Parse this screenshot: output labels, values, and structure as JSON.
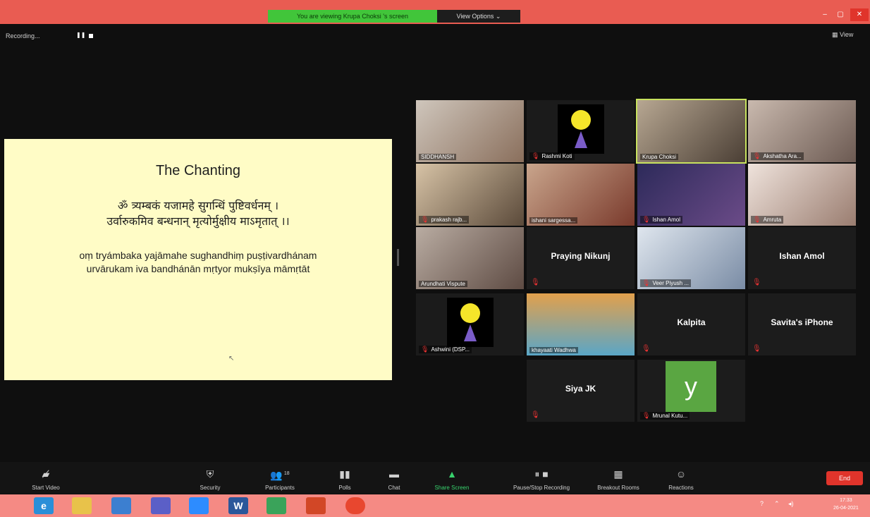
{
  "window": {
    "viewing_banner": "You are viewing Krupa Choksi 's screen",
    "view_options": "View Options ⌄",
    "min": "–",
    "max": "▢",
    "close": "✕"
  },
  "recording": {
    "label": "Recording...",
    "pause": "❚❚"
  },
  "view_button": "▦ View",
  "slide": {
    "title": "The Chanting",
    "sanskrit_line1": "ॐ त्र्यम्बकं यजामहे सुगन्धिं पुष्टिवर्धनम् ।",
    "sanskrit_line2": "उर्वारुकमिव बन्धनान् मृत्योर्मुक्षीय माऽमृतात् ।।",
    "trans_line1": "oṃ tryámbaka yajāmahe sughandhiṃ puṣṭivardhánam",
    "trans_line2": "urvārukam iva bandhánān mṛtyor mukṣīya māmṛtāt"
  },
  "participants": [
    {
      "name": "SIDDHANSH",
      "muted": false
    },
    {
      "name": "Rashmi Koti",
      "muted": true
    },
    {
      "name": "Krupa Choksi",
      "muted": false,
      "active": true
    },
    {
      "name": "Akshatha Ara...",
      "muted": true
    },
    {
      "name": "prakash rajb...",
      "muted": true
    },
    {
      "name": "ishani sargessa...",
      "muted": false
    },
    {
      "name": "Ishan Amol",
      "muted": true
    },
    {
      "name": "Amruta",
      "muted": true
    },
    {
      "name": "Arundhati Vispute",
      "muted": false
    },
    {
      "name": "Praying Nikunj",
      "muted": true,
      "video_off": true
    },
    {
      "name": "Veer Piyush ...",
      "muted": true
    },
    {
      "name": "Ishan Amol",
      "muted": true,
      "video_off": true
    },
    {
      "name": "Ashwini (DSP...",
      "muted": true
    },
    {
      "name": "khayaati Wadhwa",
      "muted": false
    },
    {
      "name": "Kalpita",
      "muted": true,
      "video_off": true
    },
    {
      "name": "Savita's iPhone",
      "muted": true,
      "video_off": true
    },
    {
      "name": "Siya JK",
      "muted": true,
      "video_off": true
    },
    {
      "name": "Mrunal Kutu...",
      "muted": true,
      "avatar_letter": "y"
    }
  ],
  "toolbar": {
    "start_video": "Start Video",
    "security": "Security",
    "participants": "Participants",
    "participants_count": "18",
    "polls": "Polls",
    "chat": "Chat",
    "share_screen": "Share Screen",
    "pause_stop_recording": "Pause/Stop Recording",
    "breakout_rooms": "Breakout Rooms",
    "reactions": "Reactions",
    "end": "End"
  },
  "taskbar": {
    "apps": [
      "e",
      "",
      "",
      "",
      "",
      "W",
      "",
      "",
      ""
    ],
    "tray_help": "?",
    "tray_arrow": "⌃",
    "tray_volume": "◂)",
    "time": "17:33",
    "date": "26-04-2021"
  },
  "colors": {
    "titlebar": "#e95c52",
    "banner": "#41c53a",
    "slide_bg": "#fffcc6",
    "end": "#e0342b",
    "share": "#38d26d",
    "taskbar": "#f58a84"
  }
}
